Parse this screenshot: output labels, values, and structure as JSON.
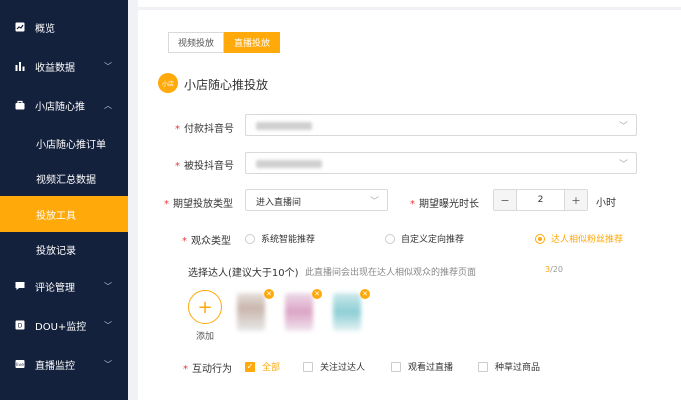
{
  "sidebar": {
    "items": [
      {
        "label": "概览",
        "icon": "chart-square-icon"
      },
      {
        "label": "收益数据",
        "icon": "bar-chart-icon"
      },
      {
        "label": "小店随心推",
        "icon": "bag-icon"
      },
      {
        "label": "小店随心推订单"
      },
      {
        "label": "视频汇总数据"
      },
      {
        "label": "投放工具"
      },
      {
        "label": "投放记录"
      },
      {
        "label": "评论管理",
        "icon": "comment-icon"
      },
      {
        "label": "DOU+监控",
        "icon": "dou-icon"
      },
      {
        "label": "直播监控",
        "icon": "live-icon"
      }
    ]
  },
  "tabs": [
    "视频投放",
    "直播投放"
  ],
  "section": {
    "logo_text": "小店",
    "title": "小店随心推投放"
  },
  "form": {
    "pay_account_label": "付款抖音号",
    "target_account_label": "被投抖音号",
    "expect_type_label": "期望投放类型",
    "expect_type_value": "进入直播间",
    "expect_duration_label": "期望曝光时长",
    "duration_value": "2",
    "duration_unit": "小时",
    "minus": "−",
    "plus": "+",
    "audience_label": "观众类型",
    "audience_options": [
      "系统智能推荐",
      "自定义定向推荐",
      "达人相似粉丝推荐"
    ],
    "talent_title": "选择达人(建议大于10个)",
    "talent_hint": "此直播间会出现在达人相似观众的推荐页面",
    "talent_count": "3",
    "talent_total": "/20",
    "add_label": "添加",
    "interaction_label": "互动行为",
    "interaction_options": [
      "全部",
      "关注过达人",
      "观看过直播",
      "种草过商品"
    ]
  },
  "colors": {
    "accent": "#ffa90a",
    "sidebar_bg": "#14213d",
    "required": "#e4393c"
  }
}
